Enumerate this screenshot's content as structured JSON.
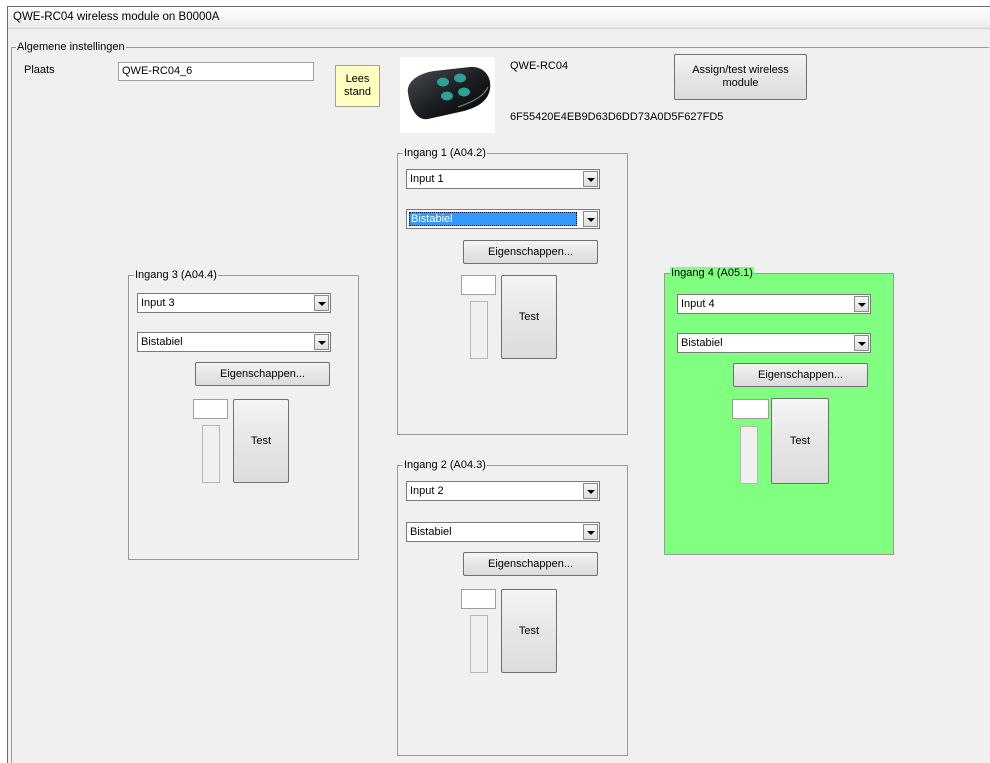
{
  "window": {
    "title": "QWE-RC04 wireless module on B0000A"
  },
  "general": {
    "legend": "Algemene instellingen",
    "plaats_label": "Plaats",
    "plaats_value": "QWE-RC04_6",
    "lees_line1": "Lees",
    "lees_line2": "stand",
    "module_name": "QWE-RC04",
    "module_id": "6F55420E4EB9D63D6DD73A0D5F627FD5",
    "assign_line1": "Assign/test wireless",
    "assign_line2": "module"
  },
  "inputs": {
    "in1": {
      "legend": "Ingang 1 (A04.2)",
      "input": "Input 1",
      "mode": "Bistabiel",
      "props": "Eigenschappen...",
      "test": "Test"
    },
    "in2": {
      "legend": "Ingang 2 (A04.3)",
      "input": "Input 2",
      "mode": "Bistabiel",
      "props": "Eigenschappen...",
      "test": "Test"
    },
    "in3": {
      "legend": "Ingang 3 (A04.4)",
      "input": "Input 3",
      "mode": "Bistabiel",
      "props": "Eigenschappen...",
      "test": "Test"
    },
    "in4": {
      "legend": "Ingang 4 (A05.1)",
      "input": "Input 4",
      "mode": "Bistabiel",
      "props": "Eigenschappen...",
      "test": "Test",
      "highlight_color": "#80ff80"
    }
  },
  "colors": {
    "active_group": "#80ff80",
    "lees_button": "#ffffc0",
    "selection": "#3399ff"
  }
}
